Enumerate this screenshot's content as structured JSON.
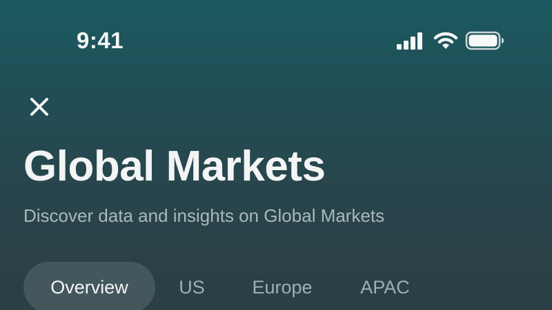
{
  "status_bar": {
    "time": "9:41",
    "icons": [
      "signal-icon",
      "wifi-icon",
      "battery-icon"
    ]
  },
  "header": {
    "close_icon": "close-icon",
    "title": "Global Markets",
    "subtitle": "Discover data and insights on Global Markets"
  },
  "tabs": [
    {
      "label": "Overview",
      "active": true
    },
    {
      "label": "US",
      "active": false
    },
    {
      "label": "Europe",
      "active": false
    },
    {
      "label": "APAC",
      "active": false
    }
  ],
  "colors": {
    "background_top": "#1b5a60",
    "background_bottom": "#2b3f45",
    "text_primary": "#f3f5f5",
    "text_secondary": "#a9b9bc",
    "tab_inactive": "#9fb0b3"
  }
}
